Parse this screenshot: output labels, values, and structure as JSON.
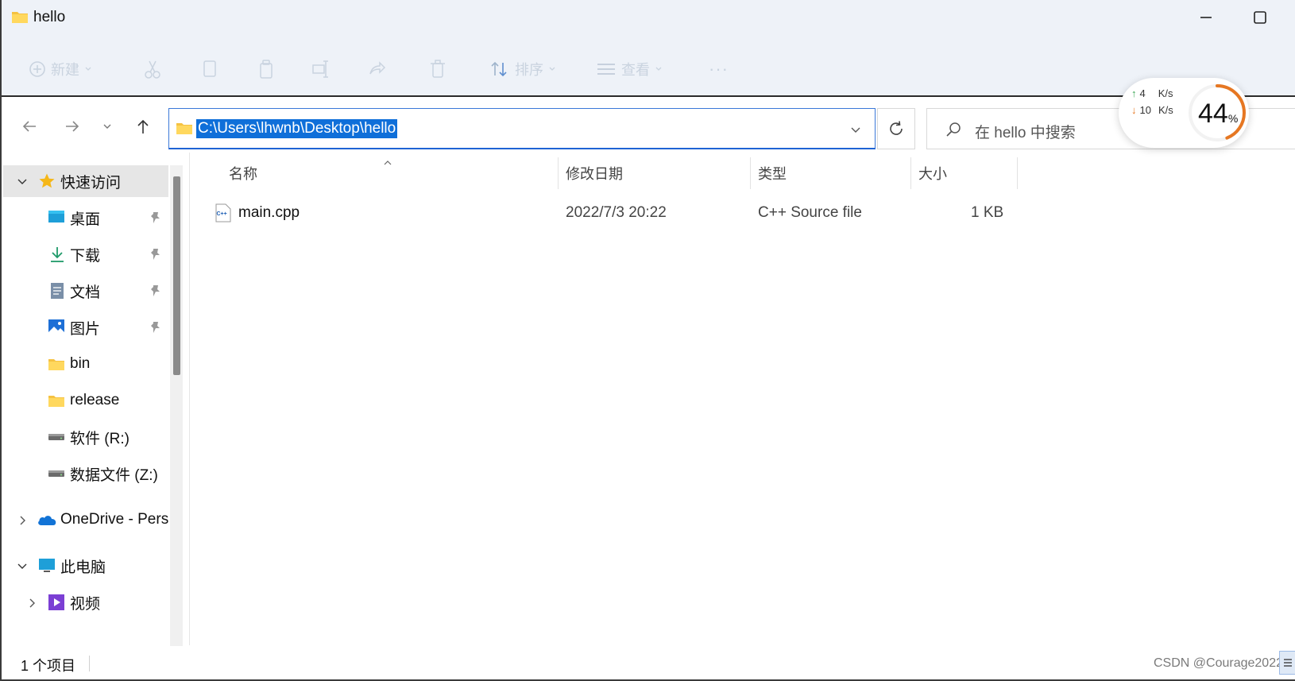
{
  "window": {
    "title": "hello"
  },
  "toolbar": {
    "new_label": "新建",
    "sort_label": "排序",
    "view_label": "查看",
    "more_label": "···"
  },
  "address": {
    "path": "C:\\Users\\lhwnb\\Desktop\\hello",
    "search_placeholder": "在 hello 中搜索"
  },
  "speed_widget": {
    "up_value": "4",
    "up_unit": "K/s",
    "down_value": "10",
    "down_unit": "K/s",
    "usage_value": "44",
    "usage_unit": "%",
    "usage_percent": 44,
    "accent_color": "#e67722"
  },
  "sidebar": {
    "quick_access": "快速访问",
    "items": [
      {
        "label": "桌面",
        "icon": "desktop-icon",
        "pinned": true
      },
      {
        "label": "下载",
        "icon": "download-icon",
        "pinned": true
      },
      {
        "label": "文档",
        "icon": "document-icon",
        "pinned": true
      },
      {
        "label": "图片",
        "icon": "pictures-icon",
        "pinned": true
      },
      {
        "label": "bin",
        "icon": "folder-icon",
        "pinned": false
      },
      {
        "label": "release",
        "icon": "folder-icon",
        "pinned": false
      },
      {
        "label": "软件 (R:)",
        "icon": "drive-icon",
        "pinned": false
      },
      {
        "label": "数据文件 (Z:)",
        "icon": "drive-icon",
        "pinned": false
      }
    ],
    "onedrive": "OneDrive - Pers",
    "this_pc": "此电脑",
    "videos": "视频"
  },
  "columns": {
    "name": "名称",
    "modified": "修改日期",
    "type": "类型",
    "size": "大小"
  },
  "files": [
    {
      "name": "main.cpp",
      "modified": "2022/7/3 20:22",
      "type": "C++ Source file",
      "size": "1 KB",
      "icon": "cpp-file-icon"
    }
  ],
  "status": {
    "item_count": "1 个项目",
    "watermark": "CSDN @Courage2022"
  }
}
